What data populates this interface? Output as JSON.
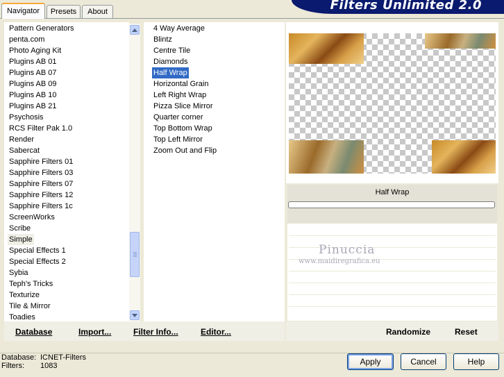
{
  "tabs": [
    {
      "label": "Navigator",
      "active": true
    },
    {
      "label": "Presets",
      "active": false
    },
    {
      "label": "About",
      "active": false
    }
  ],
  "banner": {
    "title": "Filters Unlimited 2.0"
  },
  "categories": {
    "items": [
      "Pattern Generators",
      "penta.com",
      "Photo Aging Kit",
      "Plugins AB 01",
      "Plugins AB 07",
      "Plugins AB 09",
      "Plugins AB 10",
      "Plugins AB 21",
      "Psychosis",
      "RCS Filter Pak 1.0",
      "Render",
      "Sabercat",
      "Sapphire Filters 01",
      "Sapphire Filters 03",
      "Sapphire Filters 07",
      "Sapphire Filters 12",
      "Sapphire Filters 1c",
      "ScreenWorks",
      "Scribe",
      "Simple",
      "Special Effects 1",
      "Special Effects 2",
      "Sybia",
      "Teph's Tricks",
      "Texturize",
      "Tile & Mirror",
      "Toadies"
    ],
    "highlighted": "Simple"
  },
  "filters": {
    "items": [
      "4 Way Average",
      "Blintz",
      "Centre Tile",
      "Diamonds",
      "Half Wrap",
      "Horizontal Grain",
      "Left Right Wrap",
      "Pizza Slice Mirror",
      "Quarter corner",
      "Top Bottom Wrap",
      "Top Left Mirror",
      "Zoom Out and Flip"
    ],
    "selected": "Half Wrap"
  },
  "preview": {
    "filter_name": "Half Wrap",
    "watermark_name": "Pinuccia",
    "watermark_url": "www.maidiregrafica.eu"
  },
  "toolbar": {
    "database": "Database",
    "import": "Import...",
    "filter_info": "Filter Info...",
    "editor": "Editor...",
    "randomize": "Randomize",
    "reset": "Reset"
  },
  "status": {
    "database_label": "Database:",
    "database_value": "ICNET-Filters",
    "filters_label": "Filters:",
    "filters_value": "1083"
  },
  "buttons": {
    "apply": "Apply",
    "cancel": "Cancel",
    "help": "Help"
  },
  "colors": {
    "selection": "#316ac5",
    "banner": "#0a1a6e",
    "tab_accent": "#f7a83b"
  }
}
